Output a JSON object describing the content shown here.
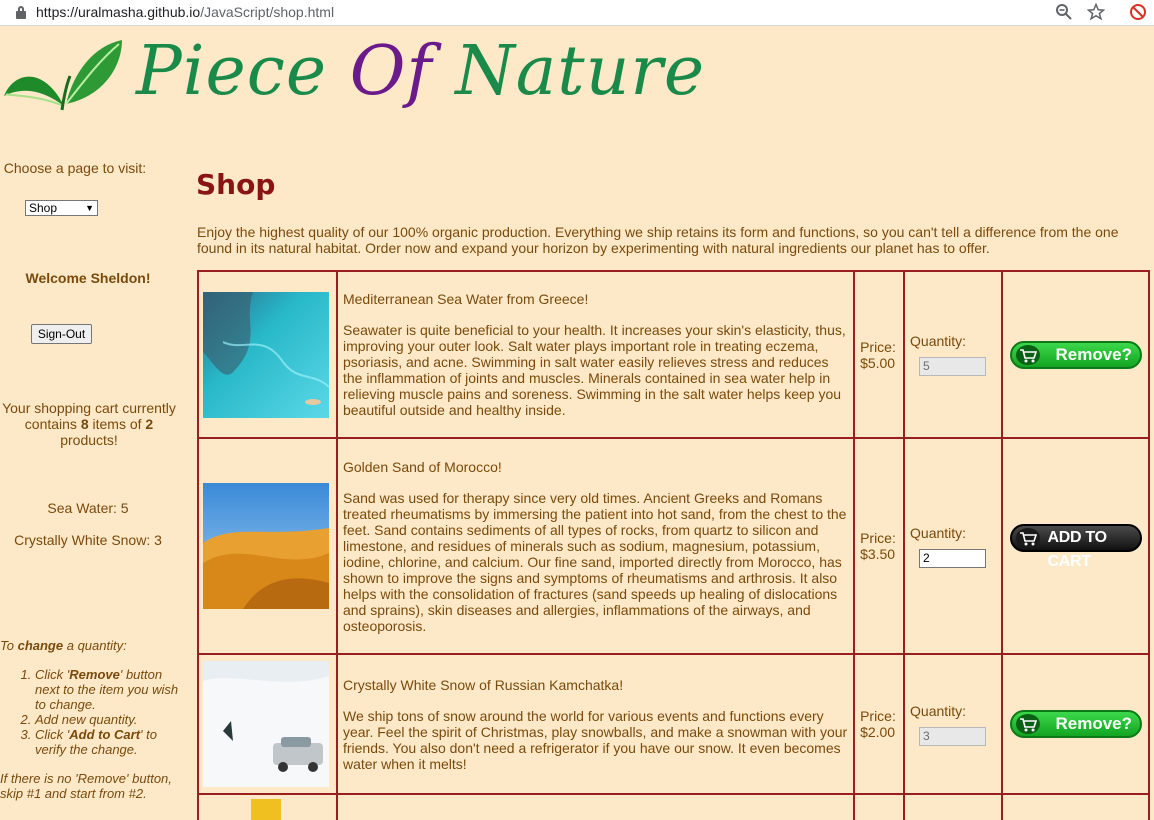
{
  "browser": {
    "url_host": "https://uralmasha.github.io",
    "url_path": "/JavaScript/shop.html"
  },
  "brand": {
    "piece": "Piece ",
    "of": "Of",
    "nature": " Nature"
  },
  "sidebar": {
    "choose_label": "Choose a page to visit:",
    "page_select_value": "Shop",
    "welcome": "Welcome Sheldon!",
    "signout_label": "Sign-Out",
    "cart_text_1": "Your shopping cart currently contains ",
    "cart_items": "8",
    "cart_text_2": " items of ",
    "cart_products": "2",
    "cart_text_3": " products!",
    "cart_list": [
      "Sea Water: 5",
      "Crystally White Snow: 3"
    ],
    "howto_intro_1": "To ",
    "howto_intro_bold": "change",
    "howto_intro_2": " a quantity:",
    "step1_a": "Click '",
    "step1_bold": "Remove",
    "step1_b": "' button next to the item you wish to change.",
    "step2": "Add new quantity.",
    "step3_a": "Click '",
    "step3_bold": "Add to Cart",
    "step3_b": "' to verify the change.",
    "note": "If there is no 'Remove' button, skip #1 and start from #2."
  },
  "main": {
    "title": "Shop",
    "intro": "Enjoy the highest quality of our 100% organic production. Everything we ship retains its form and functions, so you can't tell a difference from the one found in its natural habitat. Order now and expand your horizon by experimenting with natural ingredients our planet has to offer."
  },
  "products": [
    {
      "name": "Mediterranean Sea Water from Greece!",
      "description": "Seawater is quite beneficial to your health. It increases your skin's elasticity, thus, improving your outer look. Salt water plays important role in treating eczema, psoriasis, and acne. Swimming in salt water easily relieves stress and reduces the inflammation of joints and muscles. Minerals contained in sea water help in relieving muscle pains and soreness. Swimming in the salt water helps keep you beautiful outside and healthy inside.",
      "price_label": "Price:",
      "price": "$5.00",
      "qty_label": "Quantity:",
      "qty": "5",
      "button": "Remove?"
    },
    {
      "name": "Golden Sand of Morocco!",
      "description": "Sand was used for therapy since very old times. Ancient Greeks and Romans treated rheumatisms by immersing the patient into hot sand, from the chest to the feet. Sand contains sediments of all types of rocks, from quartz to silicon and limestone, and residues of minerals such as sodium, magnesium, potassium, iodine, chlorine, and calcium. Our fine sand, imported directly from Morocco, has shown to improve the signs and symptoms of rheumatisms and arthrosis. It also helps with the consolidation of fractures (sand speeds up healing of dislocations and sprains), skin diseases and allergies, inflammations of the airways, and osteoporosis.",
      "price_label": "Price:",
      "price": "$3.50",
      "qty_label": "Quantity:",
      "qty": "2",
      "button": "ADD TO CART"
    },
    {
      "name": "Crystally White Snow of Russian Kamchatka!",
      "description": "We ship tons of snow around the world for various events and functions every year. Feel the spirit of Christmas, play snowballs, and make a snowman with your friends. You also don't need a refrigerator if you have our snow. It even becomes water when it melts!",
      "price_label": "Price:",
      "price": "$2.00",
      "qty_label": "Quantity:",
      "qty": "3",
      "button": "Remove?"
    }
  ],
  "colors": {
    "background": "#fde9c8",
    "text": "#7a4a0c",
    "title": "#8a1414",
    "border": "#9a2020",
    "brand_green": "#1a8a4a",
    "brand_purple": "#6a1a8a"
  },
  "icons": [
    "lock-icon",
    "zoom-out-icon",
    "star-icon",
    "blocked-icon",
    "leaf-logo-icon",
    "cart-icon"
  ]
}
